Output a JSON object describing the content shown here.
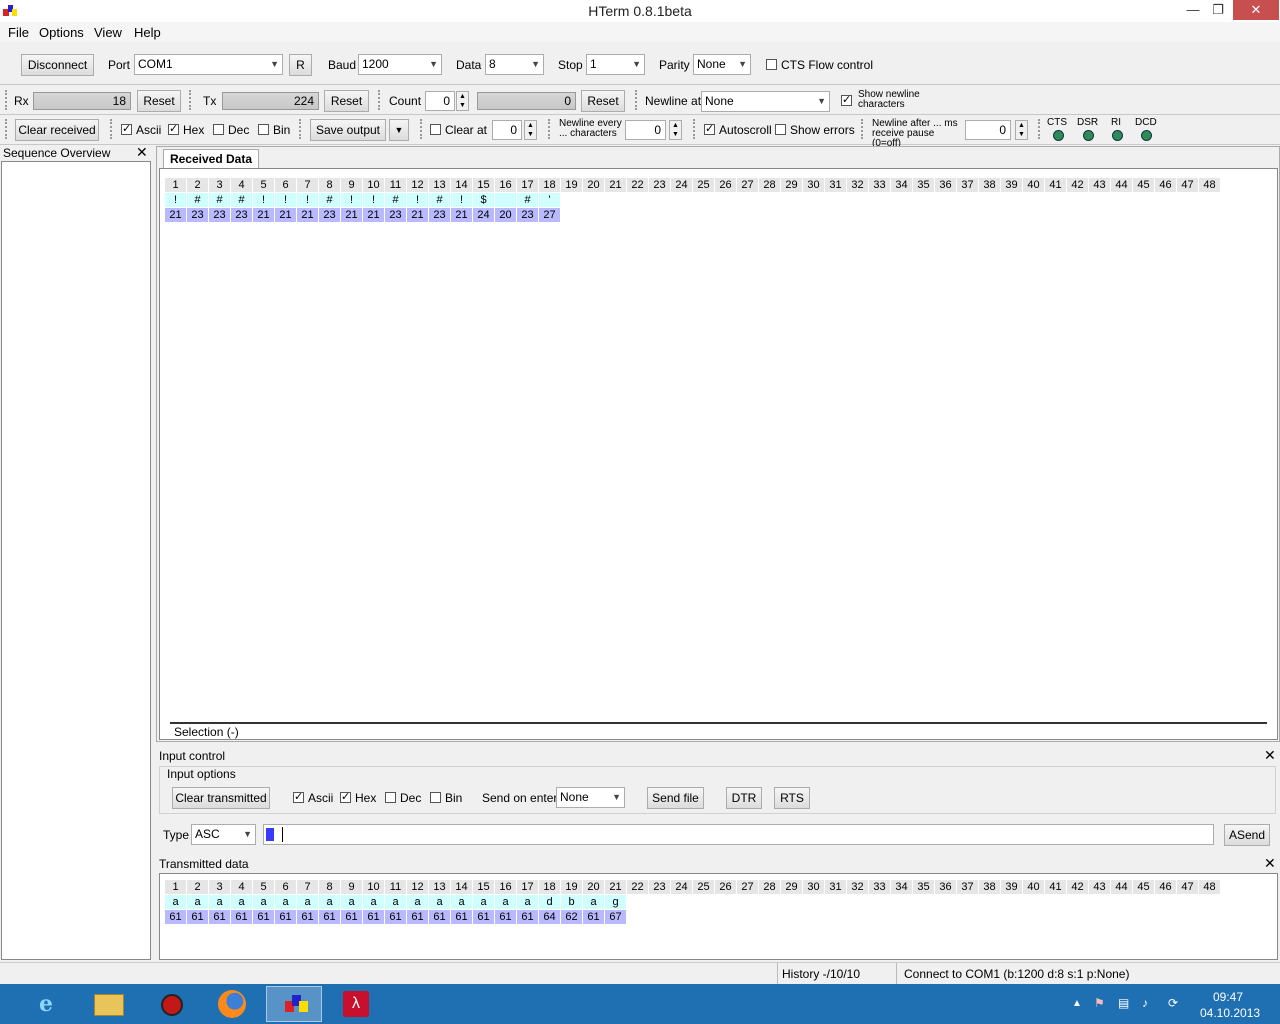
{
  "window": {
    "title": "HTerm 0.8.1beta"
  },
  "menu": [
    "File",
    "Options",
    "View",
    "Help"
  ],
  "toolbar1": {
    "disconnect": "Disconnect",
    "port_label": "Port",
    "port_value": "COM1",
    "r_button": "R",
    "baud_label": "Baud",
    "baud_value": "1200",
    "data_label": "Data",
    "data_value": "8",
    "stop_label": "Stop",
    "stop_value": "1",
    "parity_label": "Parity",
    "parity_value": "None",
    "cts_label": "CTS Flow control"
  },
  "toolbar2": {
    "rx_label": "Rx",
    "rx_value": "18",
    "reset": "Reset",
    "tx_label": "Tx",
    "tx_value": "224",
    "count_label": "Count",
    "count_value": "0",
    "count_bar_value": "0",
    "newline_at_label": "Newline at",
    "newline_at_value": "None",
    "show_newline_label": "Show newline characters"
  },
  "toolbar3": {
    "clear_received": "Clear received",
    "ascii": "Ascii",
    "hex": "Hex",
    "dec": "Dec",
    "bin": "Bin",
    "save_output": "Save output",
    "clear_at": "Clear at",
    "clear_at_value": "0",
    "newline_every": "Newline every ... characters",
    "newline_every_value": "0",
    "autoscroll": "Autoscroll",
    "show_errors": "Show errors",
    "newline_after": "Newline after ... ms receive pause (0=off)",
    "newline_after_value": "0",
    "signals": [
      "CTS",
      "DSR",
      "RI",
      "DCD"
    ]
  },
  "sequence_overview": {
    "title": "Sequence Overview"
  },
  "received": {
    "tab": "Received Data",
    "indices": [
      "1",
      "2",
      "3",
      "4",
      "5",
      "6",
      "7",
      "8",
      "9",
      "10",
      "11",
      "12",
      "13",
      "14",
      "15",
      "16",
      "17",
      "18",
      "19",
      "20",
      "21",
      "22",
      "23",
      "24",
      "25",
      "26",
      "27",
      "28",
      "29",
      "30",
      "31",
      "32",
      "33",
      "34",
      "35",
      "36",
      "37",
      "38",
      "39",
      "40",
      "41",
      "42",
      "43",
      "44",
      "45",
      "46",
      "47",
      "48"
    ],
    "ascii": [
      "!",
      "#",
      "#",
      "#",
      "!",
      "!",
      "!",
      "#",
      "!",
      "!",
      "#",
      "!",
      "#",
      "!",
      "$",
      " ",
      "#",
      "'"
    ],
    "hex": [
      "21",
      "23",
      "23",
      "23",
      "21",
      "21",
      "21",
      "23",
      "21",
      "21",
      "23",
      "21",
      "23",
      "21",
      "24",
      "20",
      "23",
      "27"
    ],
    "selection": "Selection (-)"
  },
  "input_control": {
    "title": "Input control",
    "options_title": "Input options",
    "clear_transmitted": "Clear transmitted",
    "ascii": "Ascii",
    "hex": "Hex",
    "dec": "Dec",
    "bin": "Bin",
    "send_on_enter_label": "Send on enter",
    "send_on_enter_value": "None",
    "send_file": "Send file",
    "dtr": "DTR",
    "rts": "RTS",
    "type_label": "Type",
    "type_value": "ASC",
    "asend": "ASend"
  },
  "transmitted": {
    "title": "Transmitted data",
    "ascii": [
      "a",
      "a",
      "a",
      "a",
      "a",
      "a",
      "a",
      "a",
      "a",
      "a",
      "a",
      "a",
      "a",
      "a",
      "a",
      "a",
      "a",
      "d",
      "b",
      "a",
      "g"
    ],
    "hex": [
      "61",
      "61",
      "61",
      "61",
      "61",
      "61",
      "61",
      "61",
      "61",
      "61",
      "61",
      "61",
      "61",
      "61",
      "61",
      "61",
      "61",
      "64",
      "62",
      "61",
      "67"
    ]
  },
  "statusbar": {
    "history": "History -/10/10",
    "connection": "Connect to COM1 (b:1200 d:8 s:1 p:None)"
  },
  "taskbar": {
    "time": "09:47",
    "date": "04.10.2013",
    "apps": [
      "ie-icon",
      "explorer-icon",
      "bug-icon",
      "firefox-icon",
      "hterm-icon",
      "acrobat-icon"
    ]
  }
}
